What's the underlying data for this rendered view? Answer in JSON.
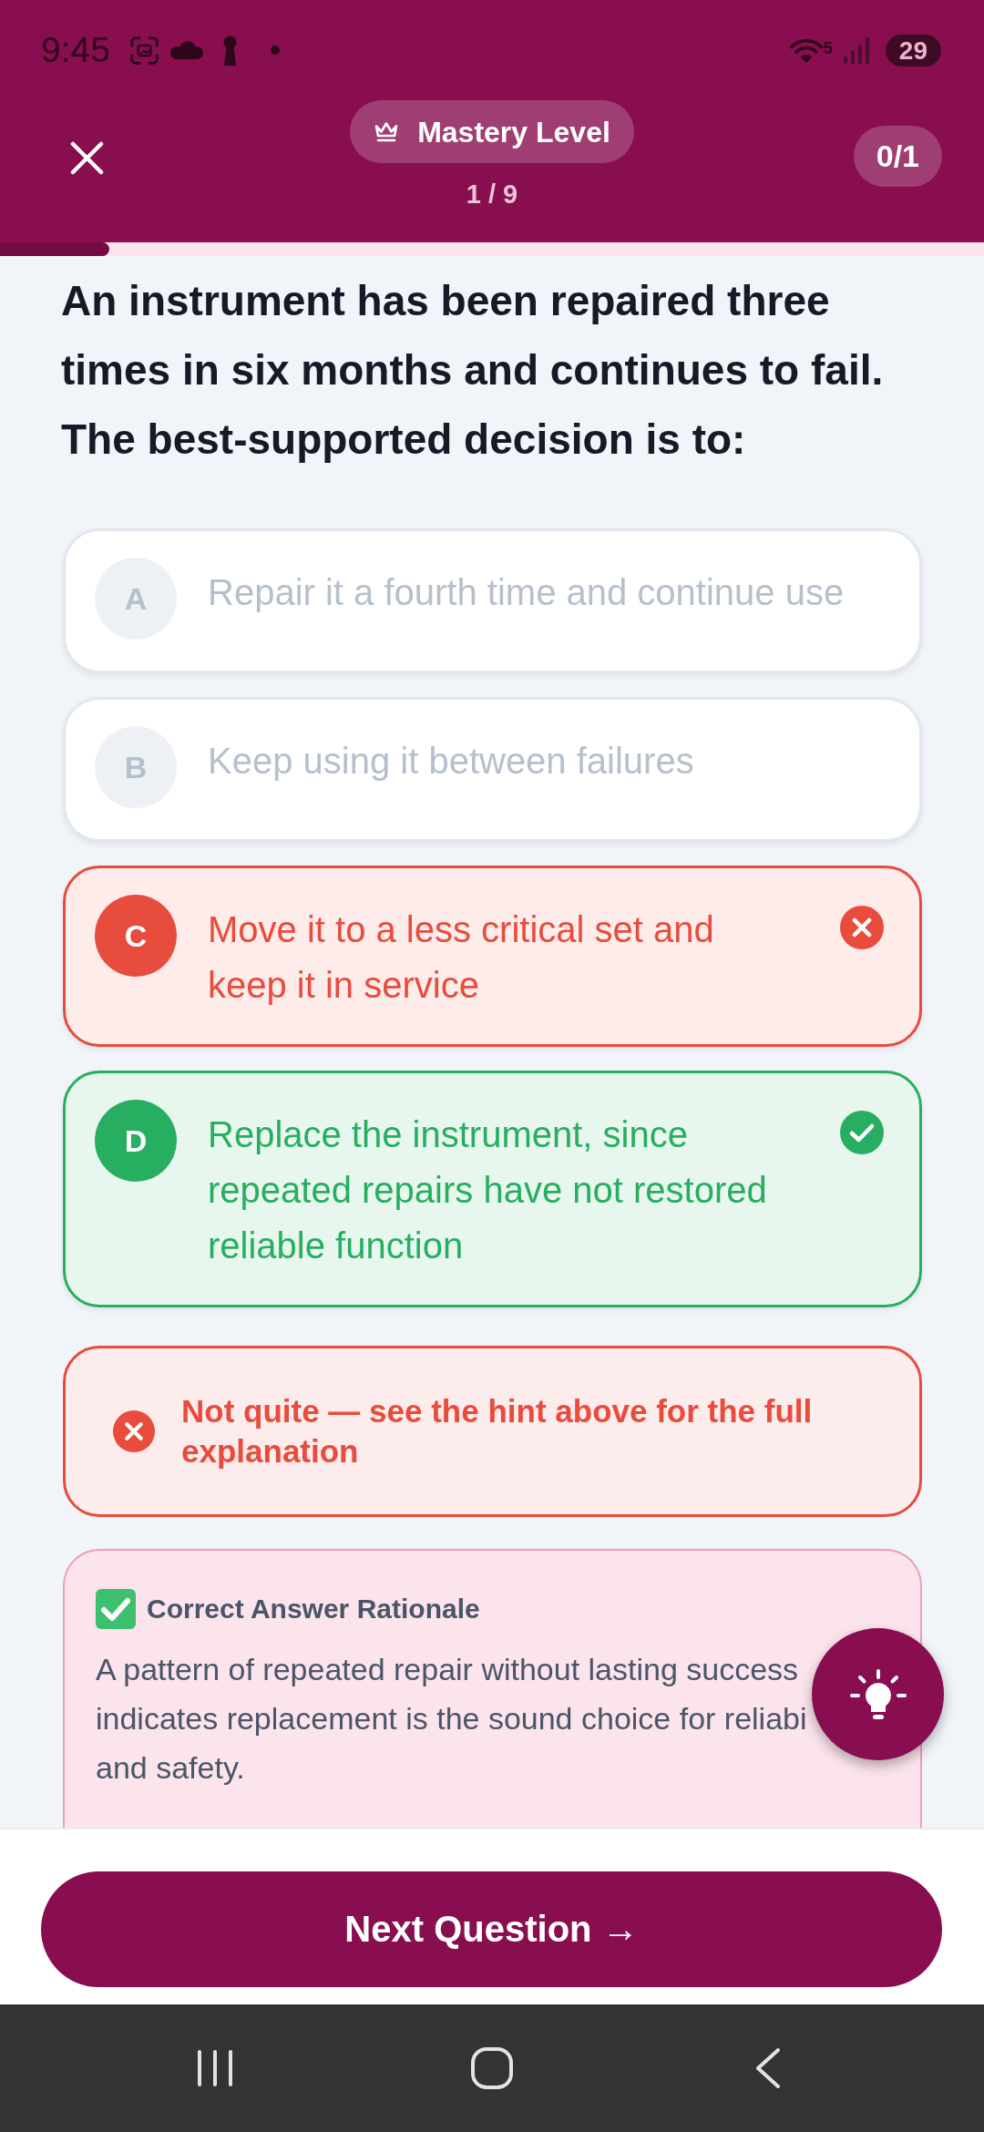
{
  "status_bar": {
    "time": "9:45",
    "network_label": "5",
    "battery": "29"
  },
  "header": {
    "badge": "Mastery Level",
    "counter": "1 / 9",
    "score": "0/1",
    "progress": {
      "level": 0.111
    }
  },
  "question": "An instrument has been repaired three times in six months and continues to fail. The best-supported decision is to:",
  "options": [
    {
      "letter": "A",
      "text": "Repair it a fourth time and continue use",
      "selected": false,
      "correct": false
    },
    {
      "letter": "B",
      "text": "Keep using it between failures",
      "selected": false,
      "correct": false
    },
    {
      "letter": "C",
      "text": "Move it to a less critical set and keep it in service",
      "selected": true,
      "correct": false
    },
    {
      "letter": "D",
      "text": "Replace the instrument, since repeated repairs have not restored reliable function",
      "selected": false,
      "correct": true
    }
  ],
  "feedback": {
    "kind": "incorrect",
    "text": "Not quite — see the hint above for the full explanation"
  },
  "rationale": {
    "title": "Correct Answer Rationale",
    "text": "A pattern of repeated repair without lasting success indicates replacement is the sound choice for reliabi and safety."
  },
  "next_button": "Next Question →"
}
